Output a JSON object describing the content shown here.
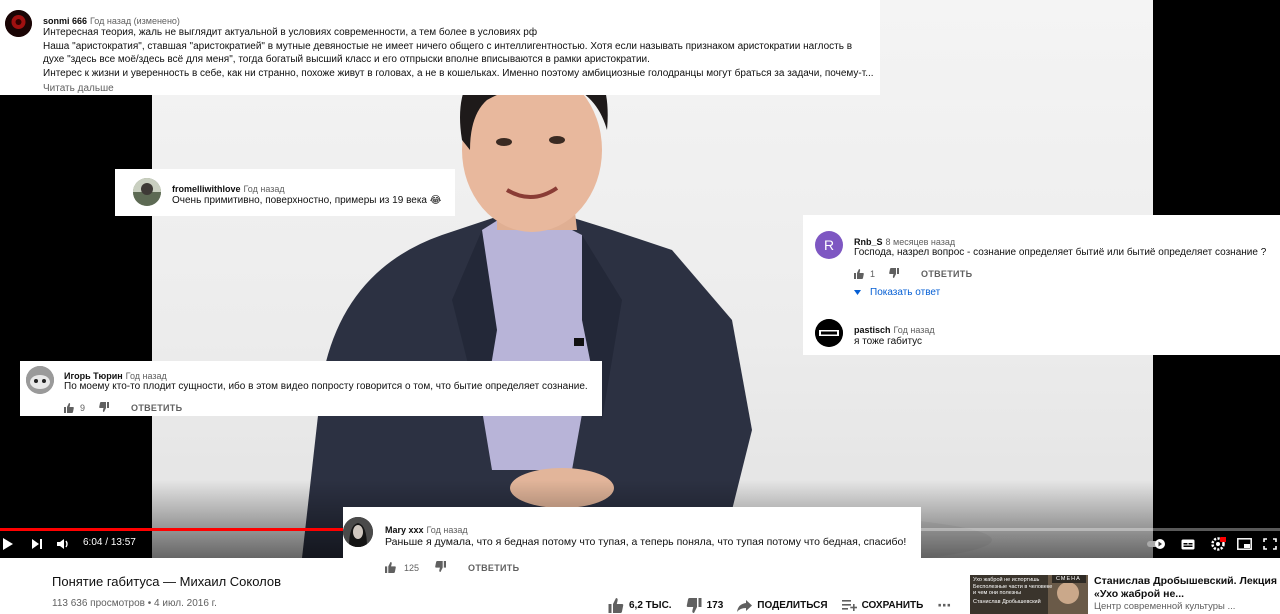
{
  "video": {
    "current_time": "6:04",
    "duration": "13:57",
    "progress": 0.435
  },
  "comments": {
    "c1": {
      "author": "sonmi 666",
      "time": "Год назад (изменено)",
      "lines": [
        "Интересная теория, жаль не выглядит актуальной в условиях современности, а тем более в условиях рф",
        "Наша \"аристократия\", ставшая \"аристократией\" в мутные девяностые не имеет ничего общего с интеллигентностью. Хотя если называть признаком аристократии наглость в",
        "духе \"здесь все моё/здесь всё для меня\", тогда богатый высший класс и его отпрыски вполне вписываются в рамки аристократии.",
        "Интерес к жизни и уверенность в себе, как ни странно, похоже живут в головах, а не в кошельках. Именно поэтому амбициозные голодранцы могут браться за задачи, почему-т..."
      ],
      "read_more": "Читать дальше"
    },
    "c2": {
      "author": "fromelliwithlove",
      "time": "Год назад",
      "text": "Очень примитивно, поверхностно, примеры из 19 века 😂"
    },
    "c3": {
      "author": "Rnb_S",
      "avatar_letter": "R",
      "time": "8 месяцев назад",
      "text": "Господа, назрел вопрос - сознание определяет бытиё или бытиё определяет сознание ?",
      "likes": "1",
      "reply": "ОТВЕТИТЬ",
      "show_reply": "Показать ответ"
    },
    "c4": {
      "author": "pastisch",
      "time": "Год назад",
      "text": "я тоже габитус"
    },
    "c5": {
      "author": "Игорь Тюрин",
      "time": "Год назад",
      "text": "По моему кто-то плодит сущности, ибо в этом видео попросту говорится о том, что бытие определяет сознание.",
      "likes": "9",
      "reply": "ОТВЕТИТЬ"
    },
    "c6": {
      "author": "Mary xxx",
      "time": "Год назад",
      "text": "Раньше я думала, что я бедная потому что тупая, а теперь поняла, что тупая потому что бедная, спасибо!",
      "likes": "125",
      "reply": "ОТВЕТИТЬ"
    }
  },
  "page": {
    "title": "Понятие габитуса — Михаил Соколов",
    "views": "113 636 просмотров",
    "date": "4 июл. 2016 г.",
    "likes": "6,2 ТЫС.",
    "dislikes": "173",
    "share": "ПОДЕЛИТЬСЯ",
    "save": "СОХРАНИТЬ"
  },
  "recommendation": {
    "title": "Станислав Дробышевский. Лекция «Ухо жаброй не...",
    "channel": "Центр современной культуры ...",
    "thumb_text_1": "Ухо жаброй не испортишь",
    "thumb_text_2": "Бесполезные части в человеке и чем они полезны",
    "thumb_text_3": "Станислав Дробышевский",
    "thumb_brand": "СМЕНА"
  },
  "colors": {
    "progress": "#ff0000",
    "avatar_r": "#7e57c2"
  }
}
